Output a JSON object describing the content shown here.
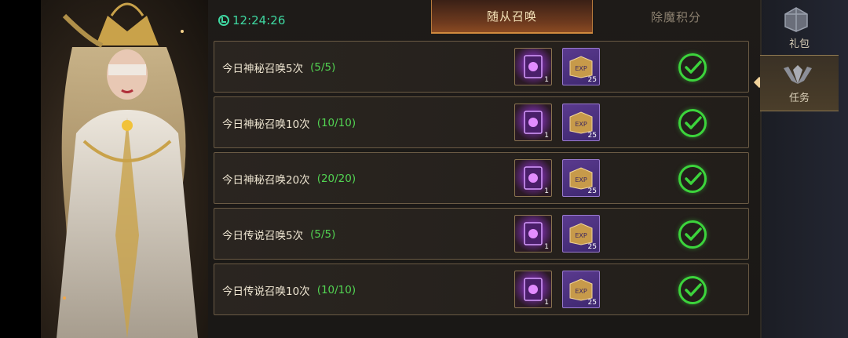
{
  "timer": "12:24:26",
  "tabs": [
    {
      "label": "随从召唤",
      "active": true
    },
    {
      "label": "除魔积分",
      "active": false
    }
  ],
  "tasks": [
    {
      "label": "今日神秘召唤5次",
      "progress": "(5/5)",
      "reward_card_count": "1",
      "reward_book_count": "25",
      "completed": true
    },
    {
      "label": "今日神秘召唤10次",
      "progress": "(10/10)",
      "reward_card_count": "1",
      "reward_book_count": "25",
      "completed": true
    },
    {
      "label": "今日神秘召唤20次",
      "progress": "(20/20)",
      "reward_card_count": "1",
      "reward_book_count": "25",
      "completed": true
    },
    {
      "label": "今日传说召唤5次",
      "progress": "(5/5)",
      "reward_card_count": "1",
      "reward_book_count": "25",
      "completed": true
    },
    {
      "label": "今日传说召唤10次",
      "progress": "(10/10)",
      "reward_card_count": "1",
      "reward_book_count": "25",
      "completed": true
    }
  ],
  "side_nav": [
    {
      "label": "礼包",
      "icon": "gift-box-icon",
      "selected": false
    },
    {
      "label": "任务",
      "icon": "wings-emblem-icon",
      "selected": true
    }
  ],
  "colors": {
    "progress_green": "#52d452",
    "timer_green": "#3fd9a2",
    "active_tab": "#8a4a22",
    "check_green": "#3cd43c"
  }
}
